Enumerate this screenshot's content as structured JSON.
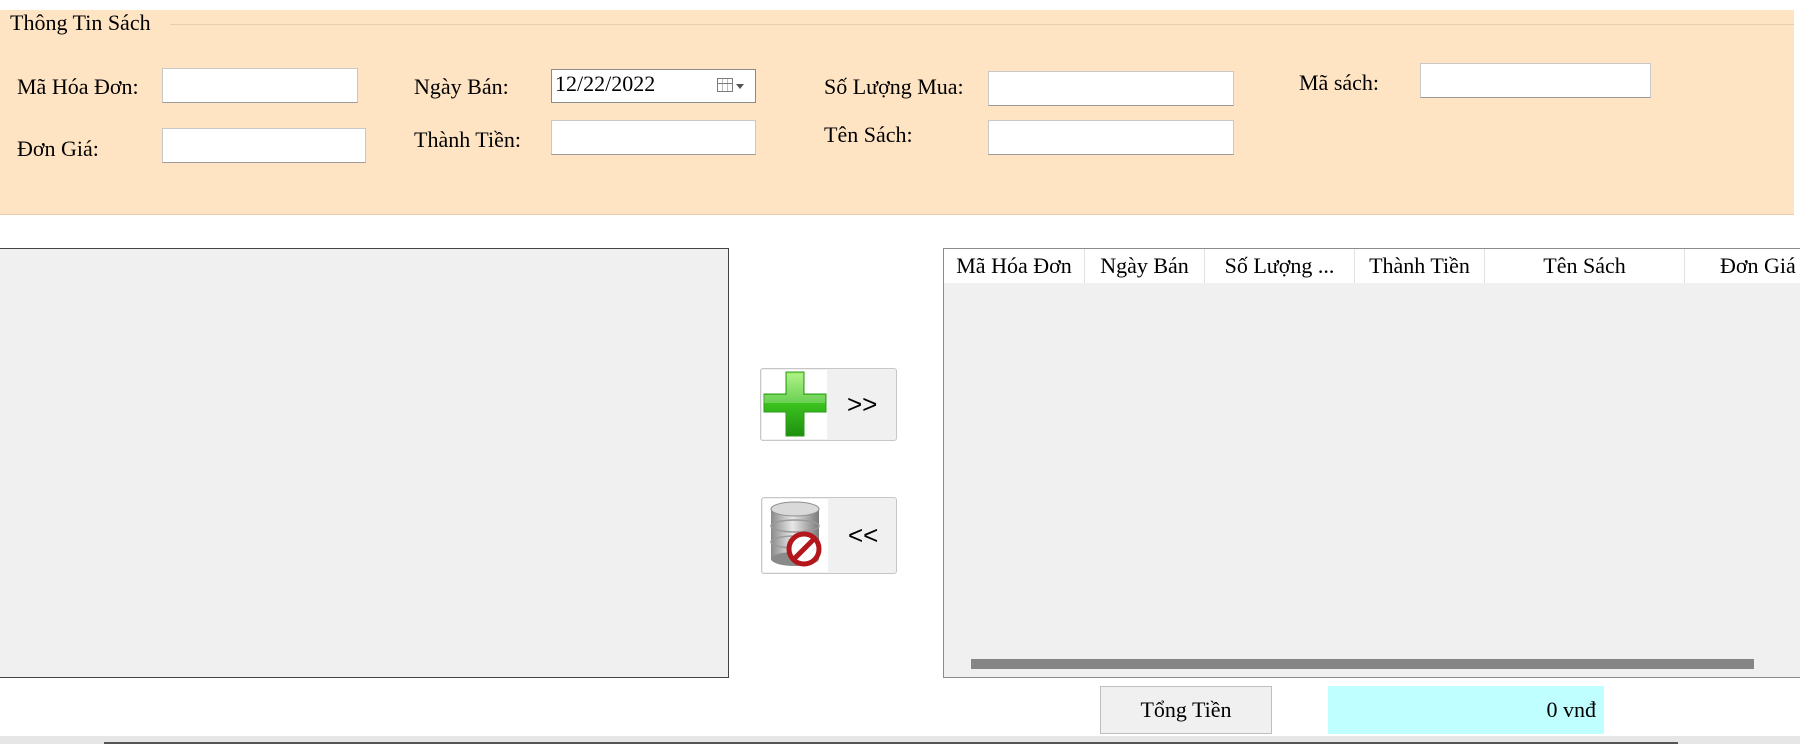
{
  "group": {
    "title": "Thông Tin Sách"
  },
  "fields": {
    "ma_hoa_don": {
      "label": "Mã Hóa Đơn:",
      "value": ""
    },
    "don_gia": {
      "label": "Đơn Giá:",
      "value": ""
    },
    "ngay_ban": {
      "label": "Ngày Bán:",
      "value": "12/22/2022"
    },
    "thanh_tien": {
      "label": "Thành Tiền:",
      "value": ""
    },
    "so_luong_mua": {
      "label": "Số Lượng Mua:",
      "value": ""
    },
    "ten_sach": {
      "label": "Tên Sách:",
      "value": ""
    },
    "ma_sach": {
      "label": "Mã sách:",
      "value": ""
    }
  },
  "buttons": {
    "add": {
      "label": ">>",
      "icon": "green-plus-icon"
    },
    "remove": {
      "label": "<<",
      "icon": "database-delete-icon"
    },
    "total": {
      "label": "Tổng Tiền"
    }
  },
  "grid": {
    "columns": [
      "Mã Hóa Đơn",
      "Ngày Bán",
      "Số Lượng ...",
      "Thành Tiền",
      "Tên Sách",
      "Đơn Giá"
    ]
  },
  "total": {
    "value": "0 vnđ"
  },
  "colors": {
    "group_bg": "#ffe4c4",
    "total_bg": "#c0ffff",
    "panel_bg": "#f0f0f0"
  }
}
